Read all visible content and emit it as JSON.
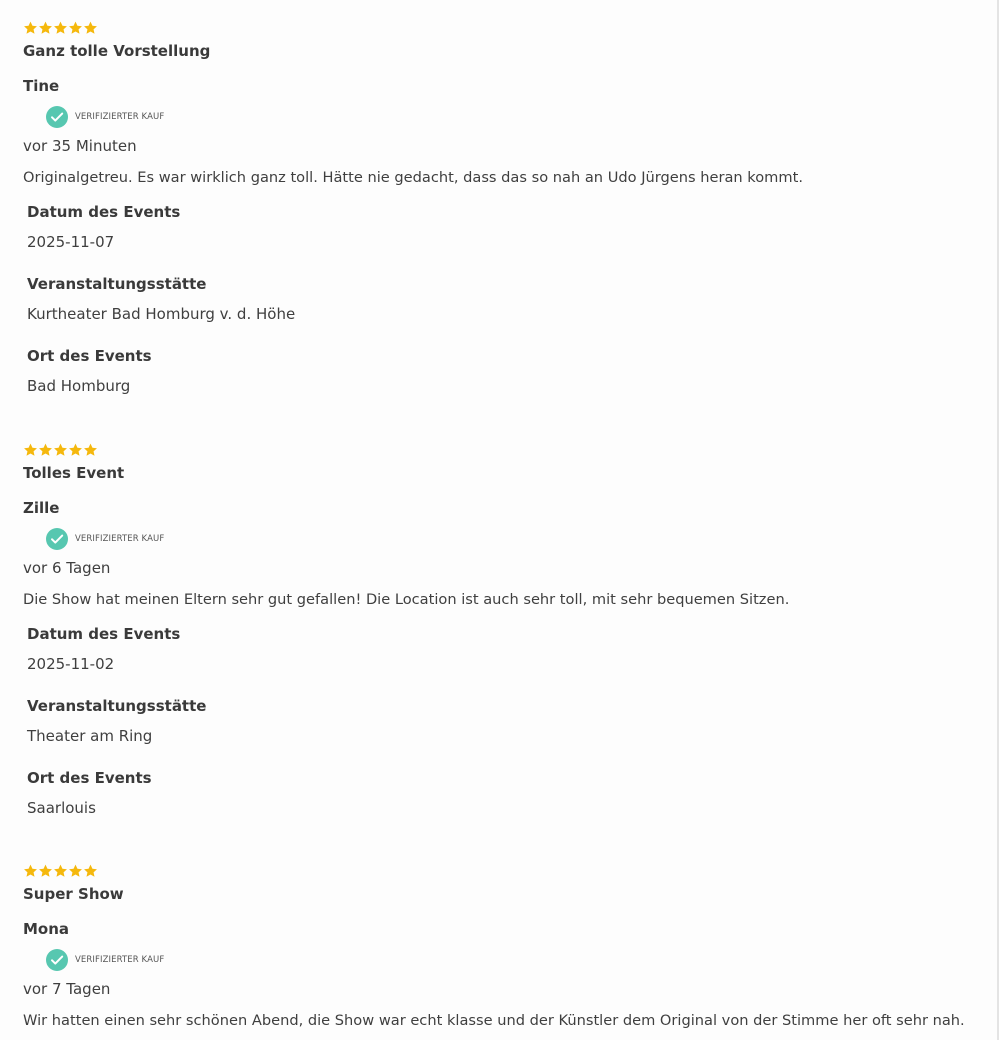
{
  "colors": {
    "star": "#f5b80d",
    "verified_badge": "#57c7b0",
    "text": "#3d3d3d"
  },
  "verified_icon": "check-circle-icon",
  "star_icon": "star-icon",
  "reviews": [
    {
      "rating": 5,
      "title": "Ganz tolle Vorstellung",
      "author": "Tine",
      "verified_label": "VERIFIZIERTER KAUF",
      "time": "vor 35 Minuten",
      "text": "Originalgetreu. Es war wirklich ganz toll. Hätte nie gedacht, dass das so nah an Udo Jürgens heran kommt.",
      "fields": [
        {
          "label": "Datum des Events",
          "value": "2025-11-07"
        },
        {
          "label": "Veranstaltungsstätte",
          "value": "Kurtheater Bad Homburg v. d. Höhe"
        },
        {
          "label": "Ort des Events",
          "value": "Bad Homburg"
        }
      ]
    },
    {
      "rating": 5,
      "title": "Tolles Event",
      "author": "Zille",
      "verified_label": "VERIFIZIERTER KAUF",
      "time": "vor 6 Tagen",
      "text": "Die Show hat meinen Eltern sehr gut gefallen! Die Location ist auch sehr toll, mit sehr bequemen Sitzen.",
      "fields": [
        {
          "label": "Datum des Events",
          "value": "2025-11-02"
        },
        {
          "label": "Veranstaltungsstätte",
          "value": "Theater am Ring"
        },
        {
          "label": "Ort des Events",
          "value": "Saarlouis"
        }
      ]
    },
    {
      "rating": 5,
      "title": "Super Show",
      "author": "Mona",
      "verified_label": "VERIFIZIERTER KAUF",
      "time": "vor 7 Tagen",
      "text": "Wir hatten einen sehr schönen Abend, die Show war echt klasse und der Künstler dem Original von der Stimme her oft sehr nah."
    }
  ]
}
